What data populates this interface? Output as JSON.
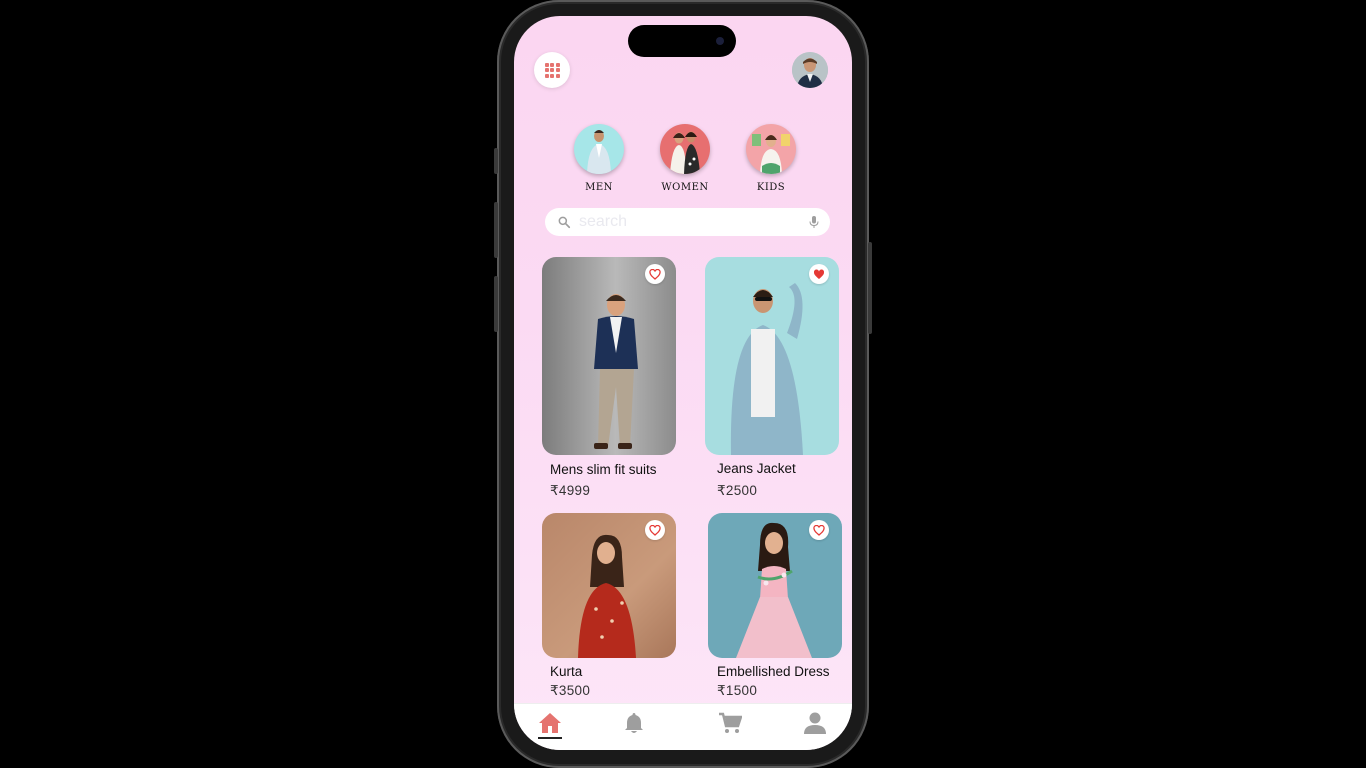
{
  "header": {
    "menu_icon": "grid-icon",
    "avatar_icon": "avatar"
  },
  "categories": [
    {
      "label": "MEN",
      "color": "#9fe3e6"
    },
    {
      "label": "WOMEN",
      "color": "#e66b6e"
    },
    {
      "label": "KIDS",
      "color": "#f2a2a6"
    }
  ],
  "search": {
    "placeholder": "search",
    "icon": "search-icon",
    "mic_icon": "mic-icon"
  },
  "products": [
    {
      "name": "Mens slim fit suits",
      "price": "₹4999",
      "favorited": false
    },
    {
      "name": "Jeans Jacket",
      "price": "₹2500",
      "favorited": true
    },
    {
      "name": "Kurta",
      "price": "₹3500",
      "favorited": false
    },
    {
      "name": "Embellished Dress",
      "price": "₹1500",
      "favorited": false
    }
  ],
  "colors": {
    "accent": "#e5736f",
    "heart": "#e53935",
    "nav_icon": "#9e9e9e"
  },
  "bottom_nav": [
    {
      "icon": "home-icon",
      "active": true
    },
    {
      "icon": "bell-icon",
      "active": false
    },
    {
      "icon": "cart-icon",
      "active": false
    },
    {
      "icon": "person-icon",
      "active": false
    }
  ]
}
